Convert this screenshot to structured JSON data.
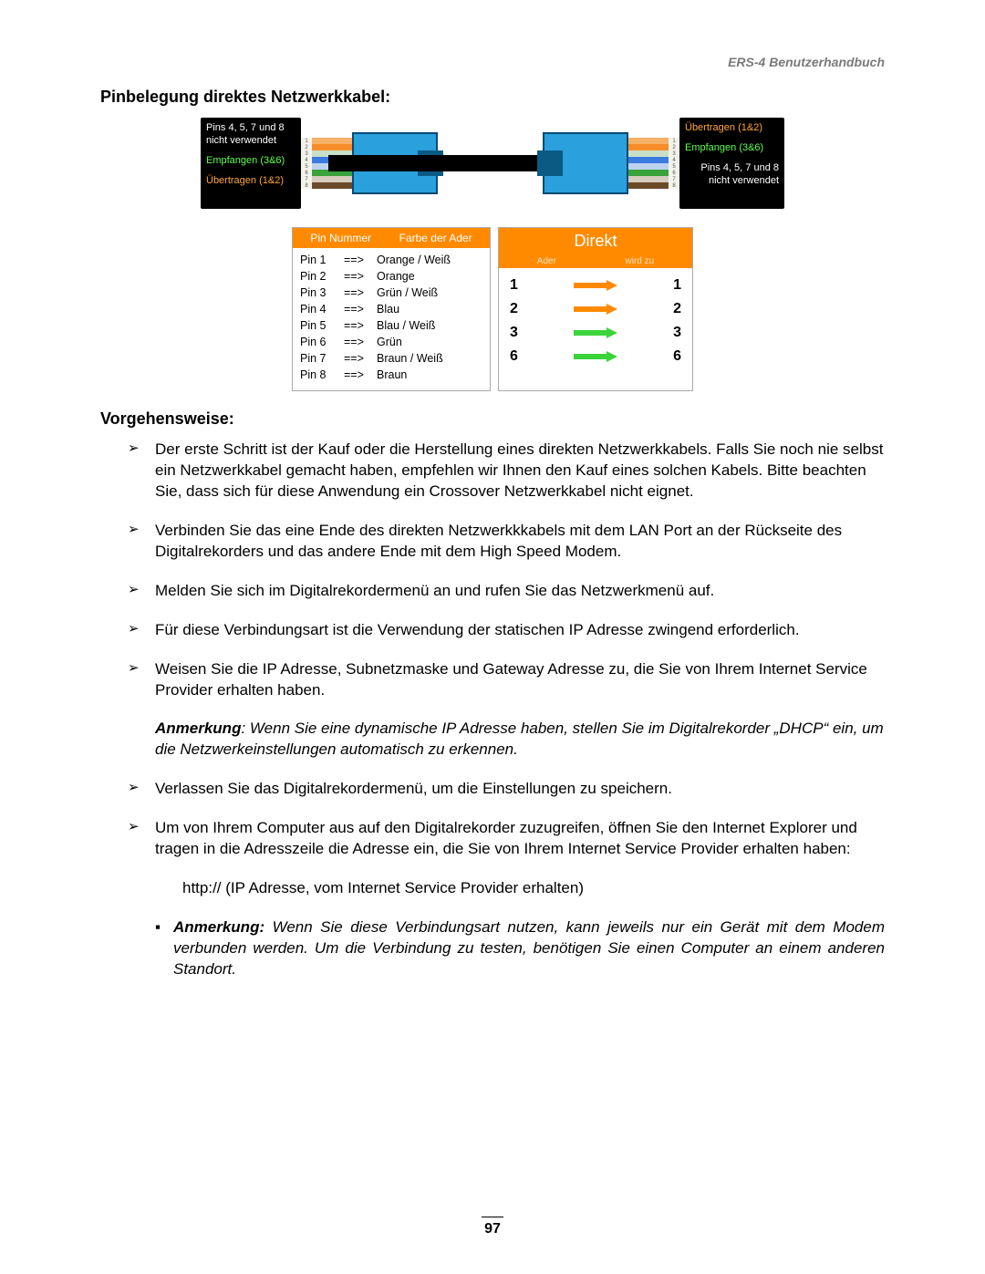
{
  "header": {
    "doc_title": "ERS-4  Benutzerhandbuch"
  },
  "section1": {
    "title": "Pinbelegung direktes Netzwerkkabel:"
  },
  "cable_labels": {
    "left_unused": "Pins 4, 5, 7 und 8\nnicht verwendet",
    "left_rx": "Empfangen (3&6)",
    "left_tx": "Übertragen (1&2)",
    "right_tx": "Übertragen (1&2)",
    "right_rx": "Empfangen (3&6)",
    "right_unused": "Pins 4, 5, 7 und 8\nnicht verwendet",
    "scale": [
      "1",
      "2",
      "3",
      "4",
      "5",
      "6",
      "7",
      "8"
    ]
  },
  "pin_table": {
    "head_pin": "Pin Nummer",
    "head_color": "Farbe der Ader",
    "rows": [
      {
        "pin": "Pin 1",
        "arrow": "==>",
        "color": "Orange / Weiß"
      },
      {
        "pin": "Pin 2",
        "arrow": "==>",
        "color": "Orange"
      },
      {
        "pin": "Pin 3",
        "arrow": "==>",
        "color": "Grün / Weiß"
      },
      {
        "pin": "Pin 4",
        "arrow": "==>",
        "color": "Blau"
      },
      {
        "pin": "Pin 5",
        "arrow": "==>",
        "color": "Blau / Weiß"
      },
      {
        "pin": "Pin 6",
        "arrow": "==>",
        "color": "Grün"
      },
      {
        "pin": "Pin 7",
        "arrow": "==>",
        "color": "Braun / Weiß"
      },
      {
        "pin": "Pin 8",
        "arrow": "==>",
        "color": "Braun"
      }
    ]
  },
  "map_table": {
    "title": "Direkt",
    "sub_left": "Ader",
    "sub_right": "wird zu",
    "rows": [
      {
        "from": "1",
        "to": "1",
        "color": "orange"
      },
      {
        "from": "2",
        "to": "2",
        "color": "orange"
      },
      {
        "from": "3",
        "to": "3",
        "color": "green"
      },
      {
        "from": "6",
        "to": "6",
        "color": "green"
      }
    ]
  },
  "section2": {
    "title": "Vorgehensweise:"
  },
  "steps": [
    "Der erste Schritt ist der Kauf oder die Herstellung eines direkten Netzwerkkabels. Falls Sie noch nie selbst ein Netzwerkkabel gemacht haben, empfehlen wir Ihnen den Kauf eines solchen Kabels. Bitte beachten Sie, dass sich für diese Anwendung ein Crossover Netzwerkkabel nicht eignet.",
    "Verbinden Sie das eine Ende des direkten Netzwerkkkabels mit dem LAN Port an der Rückseite des Digitalrekorders und das andere Ende mit dem High Speed Modem.",
    "Melden Sie sich im Digitalrekordermenü an und rufen Sie das Netzwerkmenü auf.",
    "Für diese Verbindungsart ist die Verwendung der statischen IP Adresse zwingend erforderlich.",
    "Weisen Sie die IP Adresse, Subnetzmaske und Gateway Adresse zu, die Sie von Ihrem Internet Service Provider erhalten haben."
  ],
  "note1": {
    "label": "Anmerkung",
    "text": ": Wenn Sie eine dynamische IP Adresse haben, stellen Sie im Digitalrekorder „DHCP“ ein, um die Netzwerkeinstellungen automatisch zu erkennen."
  },
  "steps_after": [
    "Verlassen Sie das Digitalrekordermenü, um die Einstellungen zu speichern.",
    "Um von Ihrem Computer aus auf den Digitalrekorder zuzugreifen, öffnen Sie den Internet Explorer und tragen in die Adresszeile die Adresse ein, die Sie von Ihrem Internet Service Provider erhalten haben:"
  ],
  "http_line": "http:// (IP Adresse, vom Internet Service Provider erhalten)",
  "note2": {
    "label": "Anmerkung:",
    "text": " Wenn Sie diese Verbindungsart nutzen, kann jeweils nur ein Gerät mit dem Modem verbunden werden. Um die Verbindung zu testen, benötigen Sie einen Computer an einem anderen Standort."
  },
  "page_number": "97"
}
